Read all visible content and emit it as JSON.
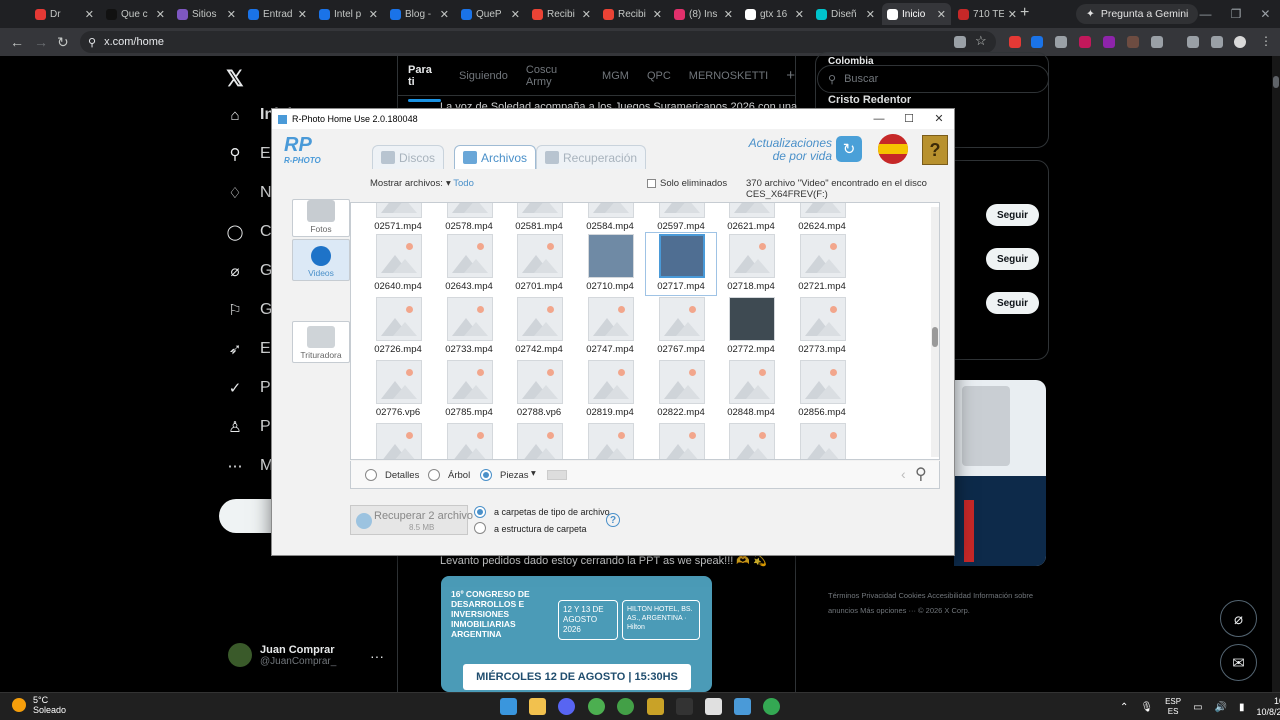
{
  "browser": {
    "tabs": [
      {
        "label": "Dr",
        "color": "#e53935"
      },
      {
        "label": "Que c",
        "color": "#111111"
      },
      {
        "label": "Sitios",
        "color": "#7e57c2"
      },
      {
        "label": "Entrad",
        "color": "#1a73e8"
      },
      {
        "label": "Intel p",
        "color": "#1a73e8"
      },
      {
        "label": "Blog -",
        "color": "#1a73e8"
      },
      {
        "label": "QueP",
        "color": "#1a73e8"
      },
      {
        "label": "Recibi",
        "color": "#ea4335"
      },
      {
        "label": "Recibi",
        "color": "#ea4335"
      },
      {
        "label": "(8) Ins",
        "color": "#e1306c"
      },
      {
        "label": "gtx 16",
        "color": "#ffffff"
      },
      {
        "label": "Diseñ",
        "color": "#00c4cc"
      },
      {
        "label": "Inicio",
        "color": "#ffffff",
        "active": true
      },
      {
        "label": "710 TE",
        "color": "#c62828"
      }
    ],
    "new_tab": "+",
    "gemini_label": "Pregunta a Gemini",
    "url": "x.com/home"
  },
  "x": {
    "nav": [
      {
        "label": "Inicio",
        "icon": "home-icon"
      },
      {
        "label": "Explorar",
        "icon": "search-icon"
      },
      {
        "label": "Notificaciones",
        "icon": "bell-icon"
      },
      {
        "label": "Chat",
        "icon": "chat-icon"
      },
      {
        "label": "Grok",
        "icon": "grok-icon"
      },
      {
        "label": "Guardados",
        "icon": "bookmark-icon"
      },
      {
        "label": "Estudio",
        "icon": "rocket-icon"
      },
      {
        "label": "Premium",
        "icon": "verified-icon"
      },
      {
        "label": "Perfil",
        "icon": "person-icon"
      },
      {
        "label": "Más",
        "icon": "more-icon"
      }
    ],
    "profile": {
      "name": "Juan Comprar",
      "handle": "@JuanComprar_"
    },
    "feed_tabs": [
      "Para ti",
      "Siguiendo",
      "Coscu Army",
      "MGM",
      "QPC",
      "MERNOSKETTI"
    ],
    "feed_text_top": "La voz de Soledad acompaña a los Juegos Suramericanos 2026 con una",
    "feed_text_bottom": "Levanto pedidos dado estoy cerrando la PPT as we speak!!! 🫶 💫",
    "promo": {
      "title": "16º CONGRESO DE DESARROLLOS E INVERSIONES INMOBILIARIAS ARGENTINA",
      "dates": "12 Y 13 DE AGOSTO 2026",
      "hotel": "HILTON HOTEL, BS. AS., ARGENTINA · Hilton",
      "bar": "MIÉRCOLES 12 DE AGOSTO | 15:30HS"
    },
    "search_placeholder": "Buscar",
    "trend_region": "Colombia",
    "trend_item": "Cristo Redentor",
    "follow_label": "Seguir",
    "footer": "Términos   Privacidad   Cookies   Accesibilidad   Información sobre anuncios   Más opciones ···   © 2026 X Corp."
  },
  "rphoto": {
    "title": "R-Photo Home Use 2.0.180048",
    "tabs": [
      "Discos",
      "Archivos",
      "Recuperación"
    ],
    "active_tab": "Archivos",
    "updates": "Actualizaciones de por vida",
    "filter_label": "Mostrar archivos:",
    "filter_value": "Todo",
    "only_deleted": "Solo eliminados",
    "found_text": "370 archivo \"Video\" encontrado en el disco CES_X64FREV(F:)",
    "side": [
      "Fotos",
      "Videos",
      "Trituradora"
    ],
    "files": [
      [
        "02571.mp4",
        "02578.mp4",
        "02581.mp4",
        "02584.mp4",
        "02597.mp4",
        "02621.mp4",
        "02624.mp4"
      ],
      [
        "02640.mp4",
        "02643.mp4",
        "02701.mp4",
        "02710.mp4",
        "02717.mp4",
        "02718.mp4",
        "02721.mp4"
      ],
      [
        "02726.mp4",
        "02733.mp4",
        "02742.mp4",
        "02747.mp4",
        "02767.mp4",
        "02772.mp4",
        "02773.mp4"
      ],
      [
        "02776.vp6",
        "02785.mp4",
        "02788.vp6",
        "02819.mp4",
        "02822.mp4",
        "02848.mp4",
        "02856.mp4"
      ],
      [
        "",
        "",
        "",
        "",
        "",
        "",
        ""
      ]
    ],
    "view_modes": [
      "Detalles",
      "Árbol",
      "Piezas"
    ],
    "active_view": "Piezas",
    "recover_label": "Recuperar 2 archivo",
    "recover_size": "8.5 MB",
    "dest_options": [
      "a carpetas de tipo de archivo",
      "a estructura de carpeta"
    ],
    "help": "?"
  },
  "taskbar": {
    "temp": "5°C",
    "condition": "Soleado",
    "lang": "ESP",
    "lang2": "ES",
    "time": "10:46",
    "date": "10/8/2026"
  }
}
